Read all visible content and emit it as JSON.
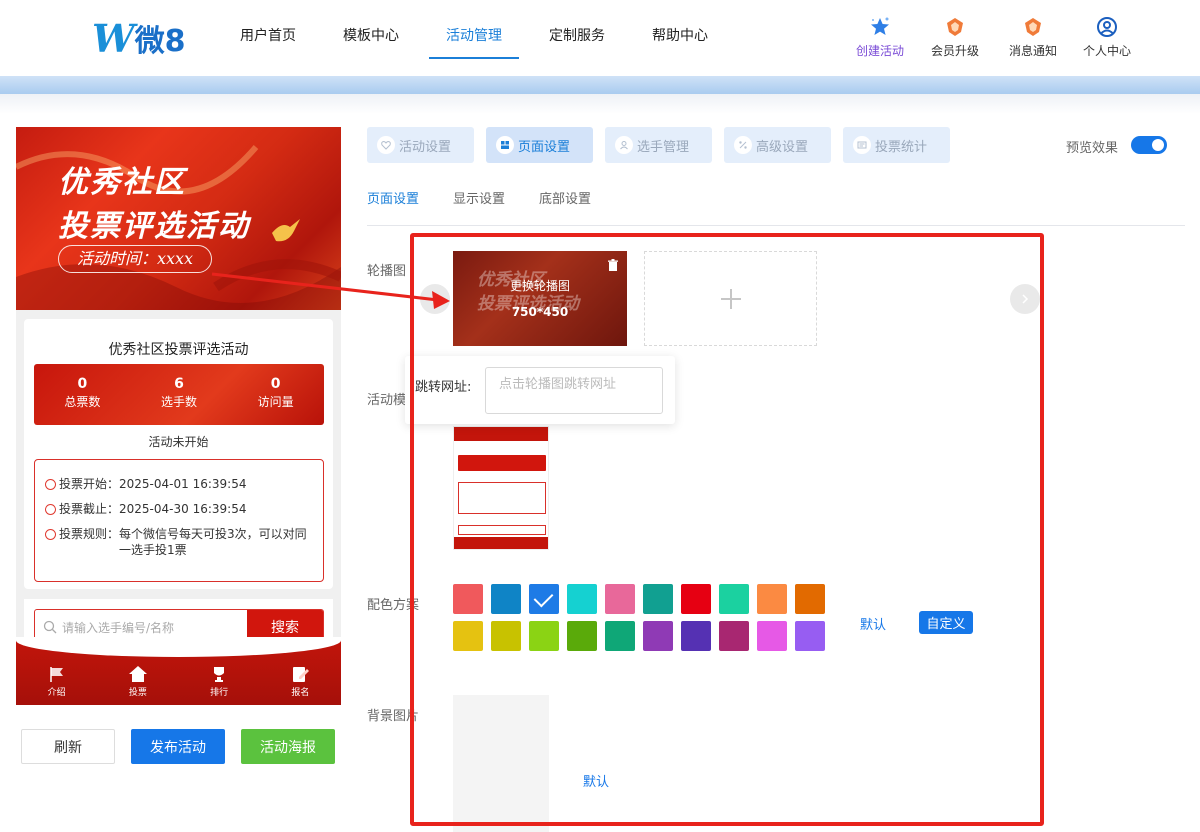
{
  "logo": {
    "w": "W",
    "text": "微8"
  },
  "nav": {
    "items": [
      "用户首页",
      "模板中心",
      "活动管理",
      "定制服务",
      "帮助中心"
    ],
    "active": 2
  },
  "top_actions": [
    {
      "label": "创建活动",
      "icon": "star-icon"
    },
    {
      "label": "会员升级",
      "icon": "medal-icon"
    },
    {
      "label": "消息通知",
      "icon": "medal-icon"
    },
    {
      "label": "个人中心",
      "icon": "user-circle-icon"
    }
  ],
  "preview": {
    "banner_line1": "优秀社区",
    "banner_line2": "投票评选活动",
    "banner_time": "活动时间：xxxx",
    "title": "优秀社区投票评选活动",
    "stats": [
      {
        "value": "0",
        "label": "总票数"
      },
      {
        "value": "6",
        "label": "选手数"
      },
      {
        "value": "0",
        "label": "访问量"
      }
    ],
    "status": "活动未开始",
    "info": [
      {
        "key": "投票开始：",
        "value": "2025-04-01 16:39:54"
      },
      {
        "key": "投票截止：",
        "value": "2025-04-30 16:39:54"
      },
      {
        "key": "投票规则：",
        "value": "每个微信号每天可投3次，可以对同一选手投1票"
      }
    ],
    "search_placeholder": "请输入选手编号/名称",
    "search_button": "搜索",
    "tabs": [
      "介绍",
      "投票",
      "排行",
      "报名"
    ]
  },
  "left_buttons": {
    "refresh": "刷新",
    "publish": "发布活动",
    "poster": "活动海报"
  },
  "setting_tabs": [
    {
      "label": "活动设置",
      "icon": "heart-icon"
    },
    {
      "label": "页面设置",
      "icon": "layout-icon"
    },
    {
      "label": "选手管理",
      "icon": "user-icon"
    },
    {
      "label": "高级设置",
      "icon": "percent-icon"
    },
    {
      "label": "投票统计",
      "icon": "chart-icon"
    }
  ],
  "active_setting_tab": 1,
  "preview_effect": {
    "label": "预览效果",
    "enabled": true
  },
  "sub_tabs": [
    "页面设置",
    "显示设置",
    "底部设置"
  ],
  "active_sub_tab": 0,
  "form": {
    "carousel_label": "轮播图",
    "carousel_change": "更换轮播图",
    "carousel_size": "750*450",
    "jump_label": "跳转网址:",
    "jump_placeholder": "点击轮播图跳转网址",
    "template_label": "活动模",
    "color_label": "配色方案",
    "color_default": "默认",
    "color_custom": "自定义",
    "background_label": "背景图片",
    "background_default": "默认"
  },
  "colors": [
    "#f0595c",
    "#0f84c6",
    "#1e7be6",
    "#15d1d1",
    "#e8689a",
    "#11a091",
    "#e60012",
    "#1bd1a0",
    "#fb8a42",
    "#e26a00",
    "#e5c211",
    "#c8c200",
    "#8bd314",
    "#5aaa0a",
    "#0fa777",
    "#8f3ab5",
    "#5531b3",
    "#a82771",
    "#e659e6",
    "#975df2"
  ],
  "selected_color": 2
}
